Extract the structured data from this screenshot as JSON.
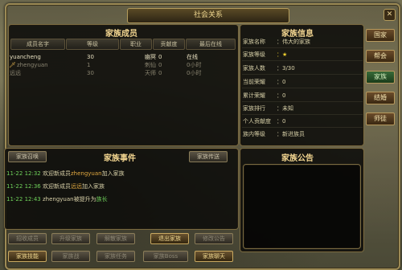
{
  "window": {
    "title": "社会关系",
    "close_glyph": "✕"
  },
  "members": {
    "title": "家族成员",
    "columns": [
      "成员名字",
      "等级",
      "职业",
      "贡献度",
      "最后在线"
    ],
    "rows": [
      {
        "name": "yuancheng",
        "level": "30",
        "job": "幽冥",
        "contrib": "0",
        "online": "在线",
        "icon": ""
      },
      {
        "name": "zhengyuan",
        "level": "1",
        "job": "刺仙",
        "contrib": "0",
        "online": "0小时",
        "icon": "sword-icon"
      },
      {
        "name": "远远",
        "level": "30",
        "job": "天师",
        "contrib": "0",
        "online": "0小时",
        "icon": ""
      }
    ]
  },
  "info": {
    "title": "家族信息",
    "items": [
      {
        "key": "家族名称",
        "value": "：伟大的家族"
      },
      {
        "key": "家族等级",
        "value": "：★"
      },
      {
        "key": "家族人数",
        "value": "：3/30"
      },
      {
        "key": "当前荣耀",
        "value": "：0"
      },
      {
        "key": "累计荣耀",
        "value": "：0"
      },
      {
        "key": "家族排行",
        "value": "：未知"
      },
      {
        "key": "个人贡献度",
        "value": "：0"
      },
      {
        "key": "族内等级",
        "value": "：新进族员"
      }
    ]
  },
  "events": {
    "title": "家族事件",
    "summon_label": "家族召唤",
    "transfer_label": "家族传送",
    "entries": [
      {
        "time": "11-22 12:32",
        "text1": "欢迎新成员",
        "name": "zhengyuan",
        "text2": "加入家族",
        "name_color": "#e0a840"
      },
      {
        "time": "11-22 12:36",
        "text1": "欢迎新成员",
        "name": "远远",
        "text2": "加入家族",
        "name_color": "#e0a840"
      },
      {
        "time": "11-22 12:43",
        "text1": "",
        "name": "zhengyuan",
        "text2": "被提升为",
        "role": "族长",
        "name_color": "#d8d0a8"
      }
    ]
  },
  "notice": {
    "title": "家族公告"
  },
  "buttons_row1": [
    {
      "label": "招收成员",
      "state": "dim"
    },
    {
      "label": "升级家族",
      "state": "dim"
    },
    {
      "label": "解散家族",
      "state": "dim"
    },
    {
      "label": "退出家族",
      "state": "active"
    },
    {
      "label": "修改公告",
      "state": "dim"
    }
  ],
  "buttons_row2": [
    {
      "label": "家族技能",
      "state": "active"
    },
    {
      "label": "家族战",
      "state": "dim"
    },
    {
      "label": "家族任务",
      "state": "dim"
    },
    {
      "label": "家族Boss",
      "state": "dim"
    },
    {
      "label": "家族聊天",
      "state": "active"
    }
  ],
  "side_tabs": [
    {
      "label": "国家",
      "active": false
    },
    {
      "label": "帮会",
      "active": false
    },
    {
      "label": "家族",
      "active": true
    },
    {
      "label": "结婚",
      "active": false
    },
    {
      "label": "师徒",
      "active": false
    }
  ]
}
